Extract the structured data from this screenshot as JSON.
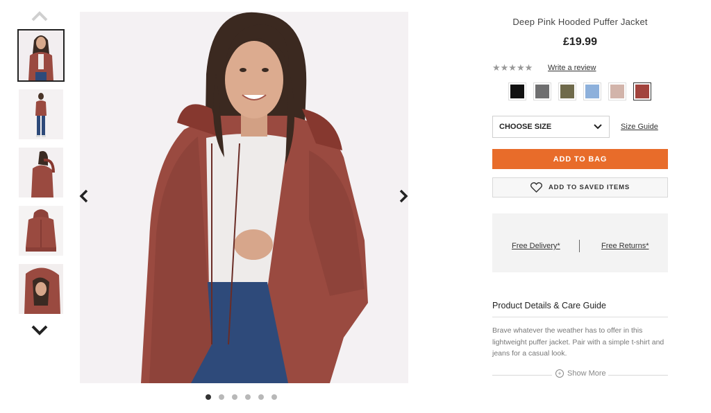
{
  "product": {
    "title": "Deep Pink Hooded Puffer Jacket",
    "price": "£19.99",
    "rating_stars": "★★★★★",
    "write_review": "Write a review"
  },
  "swatches": [
    {
      "name": "black",
      "color": "#111111"
    },
    {
      "name": "grey",
      "color": "#6f6f70"
    },
    {
      "name": "khaki",
      "color": "#6f6a4b"
    },
    {
      "name": "light-blue",
      "color": "#8db0db"
    },
    {
      "name": "mink",
      "color": "#d2b4aa"
    },
    {
      "name": "deep-pink",
      "color": "#a2433d"
    }
  ],
  "size": {
    "select_label": "CHOOSE SIZE",
    "guide_label": "Size Guide"
  },
  "actions": {
    "add_to_bag": "ADD TO BAG",
    "add_to_saved": "ADD TO SAVED ITEMS"
  },
  "delivery": {
    "free_delivery": "Free Delivery*",
    "free_returns": "Free Returns*"
  },
  "details": {
    "heading": "Product Details & Care Guide",
    "description": "Brave whatever the weather has to offer in this lightweight puffer jacket. Pair with a simple t-shirt and jeans for a casual look.",
    "show_more": "Show More"
  },
  "gallery": {
    "thumbnail_count": 5,
    "active_thumbnail": 1,
    "dot_count": 6,
    "active_dot": 1
  },
  "colors": {
    "accent": "#e86c2a",
    "jacket": "#9a4a40"
  }
}
